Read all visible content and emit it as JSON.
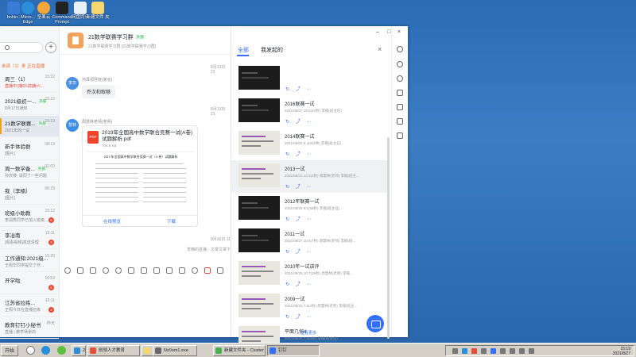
{
  "desktop": {
    "icons": [
      {
        "label": "bnhin..",
        "color": "#3a7bd5"
      },
      {
        "label": "Micro...\nEdge",
        "color": "#2a8fd8"
      },
      {
        "label": "坚果云",
        "color": "#f2a73b"
      },
      {
        "label": "Command\nPrompt",
        "color": "#222222"
      },
      {
        "label": "网盘同步",
        "color": "#e8f0fa"
      },
      {
        "label": "新建文件\n夹",
        "color": "#f5d76e"
      }
    ]
  },
  "window": {
    "controls": {
      "min": "–",
      "max": "□",
      "close": "×"
    }
  },
  "sidebar": {
    "plus": "+",
    "unread_chip": "未读（1）条 正在直播",
    "conversations": [
      {
        "title": "周三（1）",
        "tag": "",
        "sub": "直播中:[第01讲]第六...",
        "sub_red": true,
        "time": "15:22",
        "badge": "",
        "active": false,
        "bar": false
      },
      {
        "title": "2021级初一...",
        "tag": "外部",
        "sub": "8月17日通知",
        "sub_red": false,
        "time": "15:22",
        "badge": "",
        "active": false,
        "bar": false
      },
      {
        "title": "21数学联赛...",
        "tag": "外部",
        "sub": "2021年的一试",
        "sub_red": false,
        "time": "15:19",
        "badge": "",
        "active": true,
        "bar": true
      },
      {
        "title": "新手体验群",
        "tag": "",
        "sub": "[图片]",
        "sub_red": false,
        "time": "08-13",
        "badge": "",
        "active": false,
        "bar": false
      },
      {
        "title": "周一数学备...",
        "tag": "外部",
        "sub": "孙庆楼: 请同了一些问题",
        "sub_red": false,
        "time": "02-02",
        "badge": "",
        "active": false,
        "bar": false
      },
      {
        "title": "我（李楠）",
        "tag": "",
        "sub": "[图片]",
        "sub_red": false,
        "time": "08-29",
        "badge": "",
        "active": false,
        "bar": false
      },
      {
        "title": "班级小助教",
        "tag": "",
        "sub": "李润秀同学已加入班级...",
        "sub_red": false,
        "time": "15:12",
        "badge": "6",
        "active": false,
        "bar": false
      },
      {
        "title": "李冶南",
        "tag": "",
        "sub": "[观看视频]发送清理",
        "sub_red": false,
        "time": "15:11",
        "badge": "2",
        "active": false,
        "bar": false
      },
      {
        "title": "工作通知:2021级...",
        "tag": "",
        "sub": "王佩华同学提交了作...",
        "sub_red": false,
        "time": "15:20",
        "badge": "",
        "active": false,
        "bar": false
      },
      {
        "title": "开学啦",
        "tag": "",
        "sub": "",
        "sub_red": false,
        "time": "10:53",
        "badge": "6",
        "active": false,
        "bar": false
      },
      {
        "title": "江苏省拉练...",
        "tag": "",
        "sub": "王佩今日在直播拉练",
        "sub_red": false,
        "time": "15:11",
        "badge": "2",
        "active": false,
        "bar": false
      },
      {
        "title": "教育钉钉小秘书",
        "tag": "",
        "sub": "直播 | 教学场景的",
        "sub_red": false,
        "time": "昨天",
        "badge": "",
        "active": false,
        "bar": false
      }
    ]
  },
  "chat": {
    "group_name": "21数学联赛学习群",
    "group_tag": "外部",
    "group_sub": "21数学联赛学习群 [21数学联赛学习群]",
    "ts1": "8月13日 21",
    "msg1_avatar": "李华",
    "msg1_sender": "鸿泽领导班(家长)",
    "msg1_text": "乔次和取够",
    "ts2": "8月13日 21",
    "msg2_avatar": "慧林",
    "msg2_sender": "周慧林老师(老师)",
    "file": {
      "icon": "PDF",
      "name": "2019年全国高中数学联合竞赛一试(A卷)试题解析.pdf",
      "size": "706.6 KB",
      "preview_title": "2019 年全国高中数学联合竞赛一试（A 卷）试题解析",
      "action_preview": "在线预览",
      "action_download": "下载"
    },
    "ts3": "8月16日 11",
    "note": "李楠的直播：文章文章下"
  },
  "panel": {
    "tabs": [
      "全部",
      "我发起的"
    ],
    "close": "×",
    "items": [
      {
        "title": "",
        "meta": "",
        "thumb": "dark"
      },
      {
        "title": "2016联赛一试",
        "meta": "2021/08/07 18:5(42秒) 李楠(班主任)",
        "thumb": "dark"
      },
      {
        "title": "2014联赛一试",
        "meta": "2021/08/02 9:4(9分钟) 李楠(班主任)",
        "thumb": "light"
      },
      {
        "title": "2013一试",
        "meta": "2021/08/31 13:4(4秒) 周慧林(老师) 李楠(班主...",
        "thumb": "light"
      },
      {
        "title": "2012年联赛一试",
        "meta": "2021/08/26 9:1(59秒) 李楠(班主任)",
        "thumb": "dark"
      },
      {
        "title": "2011一试",
        "meta": "2021/08/27 10:4(7秒) 周慧林(老师) 李楠(班...",
        "thumb": "dark"
      },
      {
        "title": "2010年一试讲评",
        "meta": "2021/08/25 10:7(29秒) 周慧林(老师) 李楠...",
        "thumb": "light"
      },
      {
        "title": "2009一试",
        "meta": "2021/08/23 7:5(2秒) 周慧林(老师) 李楠(班主...",
        "thumb": "light"
      },
      {
        "title": "平面几何4",
        "meta": "2021/08/20 7:3(4秒) 李楠(班主任)",
        "thumb": "light"
      }
    ],
    "actions": "↻ ⤴ ⋯",
    "more": "查看更多"
  },
  "taskbar": {
    "start": "开始",
    "buttons": [
      {
        "label": "2",
        "icon_color": "#2a8fd8",
        "active": false
      },
      {
        "label": "创领人才教育",
        "icon_color": "#e84c3d",
        "active": false
      },
      {
        "label": "",
        "icon_color": "#f5d76e",
        "active": false
      },
      {
        "label": "Nz0om1.exe",
        "icon_color": "#666666",
        "active": false
      },
      {
        "label": "新建文件夹 - Cluster",
        "icon_color": "#4caf50",
        "active": false
      },
      {
        "label": "钉钉",
        "icon_color": "#3370ff",
        "active": true
      }
    ],
    "time": "15:19",
    "date": "2021/8/27"
  }
}
